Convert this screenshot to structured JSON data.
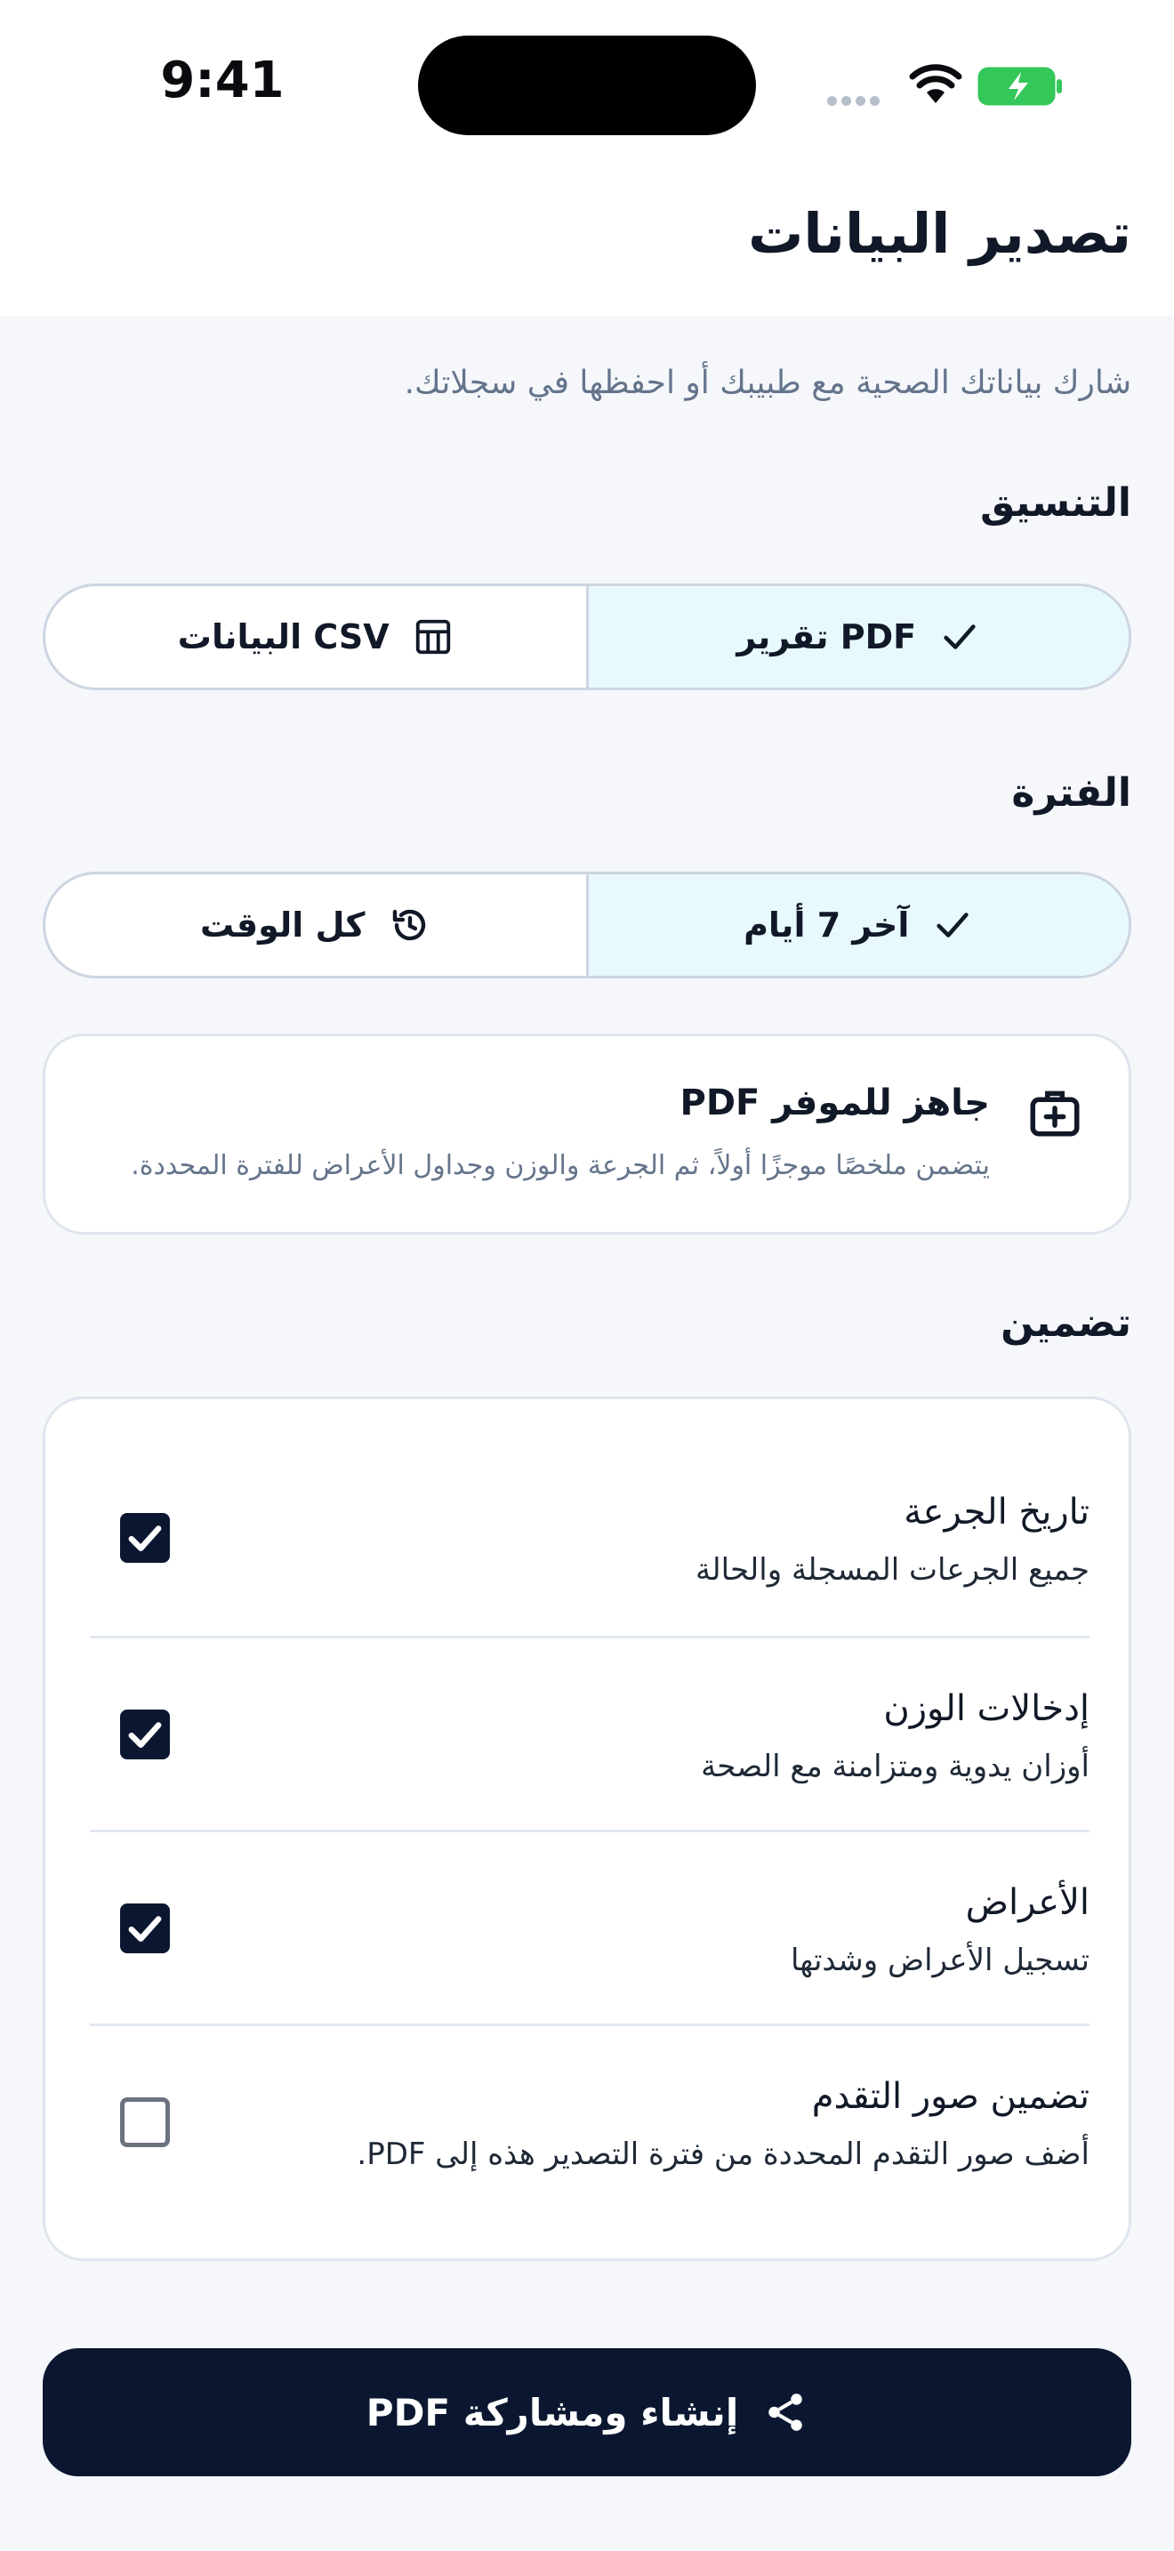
{
  "status_bar": {
    "time": "9:41"
  },
  "header": {
    "title": "تصدير البيانات"
  },
  "subtitle": "شارك بياناتك الصحية مع طبيبك أو احفظها في سجلاتك.",
  "format": {
    "label": "التنسيق",
    "options": [
      {
        "label": "PDF تقرير",
        "icon": "check-icon",
        "selected": true
      },
      {
        "label": "CSV البيانات",
        "icon": "table-icon",
        "selected": false
      }
    ]
  },
  "period": {
    "label": "الفترة",
    "options": [
      {
        "label": "آخر 7 أيام",
        "icon": "check-icon",
        "selected": true
      },
      {
        "label": "كل الوقت",
        "icon": "history-icon",
        "selected": false
      }
    ]
  },
  "info": {
    "title": "جاهز للموفر PDF",
    "description": "يتضمن ملخصًا موجزًا أولاً، ثم الجرعة والوزن وجداول الأعراض للفترة المحددة.",
    "icon": "medical-kit-icon"
  },
  "include": {
    "label": "تضمين",
    "items": [
      {
        "title": "تاريخ الجرعة",
        "subtitle": "جميع الجرعات المسجلة والحالة",
        "checked": true
      },
      {
        "title": "إدخالات الوزن",
        "subtitle": "أوزان يدوية ومتزامنة مع الصحة",
        "checked": true
      },
      {
        "title": "الأعراض",
        "subtitle": "تسجيل الأعراض وشدتها",
        "checked": true
      },
      {
        "title": "تضمين صور التقدم",
        "subtitle": "أضف صور التقدم المحددة من فترة التصدير هذه إلى PDF.",
        "checked": false
      }
    ]
  },
  "cta": {
    "label": "إنشاء ومشاركة PDF",
    "icon": "share-icon"
  },
  "colors": {
    "primary": "#0b1730",
    "accent_bg": "#e8f9fd",
    "background": "#f5f7fb",
    "battery": "#34c759"
  }
}
